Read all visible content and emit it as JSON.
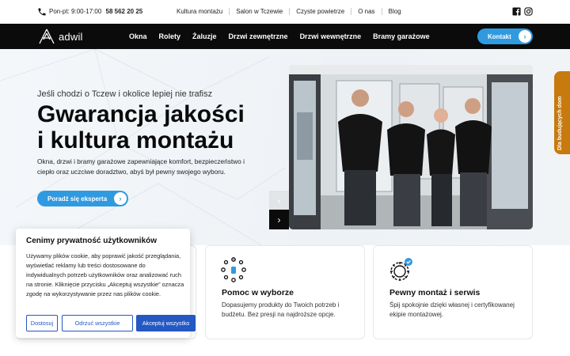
{
  "topbar": {
    "hours_label": "Pon-pt: 9:00-17:00",
    "phone": "58 562 20 25",
    "links": [
      "Kultura montażu",
      "Salon w Tczewie",
      "Czyste powietrze",
      "O nas",
      "Blog"
    ]
  },
  "nav": {
    "logo_text": "adwil",
    "items": [
      "Okna",
      "Rolety",
      "Żaluzje",
      "Drzwi zewnętrzne",
      "Drzwi wewnętrzne",
      "Bramy garażowe"
    ],
    "contact_label": "Kontakt"
  },
  "hero": {
    "subtitle": "Jeśli chodzi o Tczew i okolice lepiej nie trafisz",
    "headline_line1": "Gwarancja jakości",
    "headline_line2": "i kultura montażu",
    "description": "Okna, drzwi i bramy garażowe zapewniające komfort, bezpieczeństwo i ciepło oraz uczciwe doradztwo, abyś był pewny swojego wyboru.",
    "cta_label": "Poradź się eksperta"
  },
  "side_tab": "Dla budujących dom",
  "features": [
    {
      "title": "Pomoc w wyborze",
      "text": "Dopasujemy produkty do Twoich potrzeb i budżetu. Bez presji na najdroższe opcje."
    },
    {
      "title": "Pewny montaż i serwis",
      "text": "Śpij spokojnie dzięki własnej i certyfikowanej ekipie montażowej."
    }
  ],
  "cookie": {
    "title": "Cenimy prywatność użytkowników",
    "body": "Używamy plików cookie, aby poprawić jakość przeglądania, wyświetlać reklamy lub treści dostosowane do indywidualnych potrzeb użytkowników oraz analizować ruch na stronie. Kliknięcie przycisku „Akceptuj wszystkie” oznacza zgodę na wykorzystywanie przez nas plików cookie.",
    "btn_customize": "Dostosuj",
    "btn_reject": "Odrzuć wszystkie",
    "btn_accept": "Akceptuj wszystko"
  },
  "colors": {
    "accent": "#2f9ae0",
    "dark": "#0b0b0b",
    "side_tab": "#c77a0d",
    "cookie_blue": "#2458c2"
  },
  "icons": [
    "phone-icon",
    "facebook-icon",
    "instagram-icon",
    "chevron-right-icon",
    "chevron-left-icon",
    "options-network-icon",
    "gear-check-icon"
  ]
}
